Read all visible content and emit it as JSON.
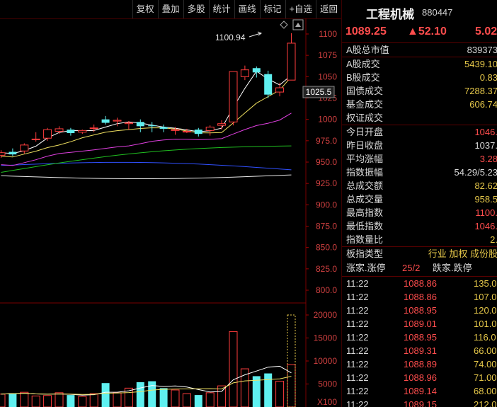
{
  "toolbar": {
    "items": [
      "复权",
      "叠加",
      "多股",
      "统计",
      "画线",
      "标记",
      "+自选",
      "返回"
    ]
  },
  "colors": {
    "up": "#ff3d3d",
    "down": "#5ff0f0",
    "ma5": "#ffffff",
    "ma10": "#f0e060",
    "ma20": "#e040e0",
    "ma60": "#20c020",
    "ma120": "#3050ff",
    "ma250": "#e8e8e8",
    "bg": "#000000"
  },
  "chart": {
    "panel_icons": [
      "diamond-icon",
      "scroll-up-icon"
    ],
    "high_label": "1100.94",
    "current_price_tag": "1025.5",
    "price_axis_ticks": [
      "1100",
      "1075",
      "1050",
      "1025",
      "1000",
      "975.0",
      "950.0",
      "925.0",
      "900.0",
      "875.0",
      "850.0",
      "825.0",
      "800.0"
    ],
    "volume_axis_ticks": [
      "20000",
      "15000",
      "10000",
      "5000"
    ],
    "volume_unit": "X100"
  },
  "chart_data": {
    "type": "candlestick",
    "ylim": [
      800,
      1100
    ],
    "volume_ylim": [
      0,
      20000
    ],
    "candles": [
      {
        "o": 958,
        "h": 964,
        "l": 955,
        "c": 961
      },
      {
        "o": 962,
        "h": 966,
        "l": 957,
        "c": 959
      },
      {
        "o": 963,
        "h": 972,
        "l": 960,
        "c": 970
      },
      {
        "o": 977,
        "h": 985,
        "l": 974,
        "c": 977
      },
      {
        "o": 978,
        "h": 990,
        "l": 975,
        "c": 988
      },
      {
        "o": 986,
        "h": 992,
        "l": 983,
        "c": 989
      },
      {
        "o": 988,
        "h": 990,
        "l": 981,
        "c": 984
      },
      {
        "o": 985,
        "h": 988,
        "l": 983,
        "c": 987
      },
      {
        "o": 990,
        "h": 994,
        "l": 985,
        "c": 990
      },
      {
        "o": 1000,
        "h": 1004,
        "l": 994,
        "c": 996
      },
      {
        "o": 998,
        "h": 1002,
        "l": 992,
        "c": 999
      },
      {
        "o": 995,
        "h": 998,
        "l": 988,
        "c": 996
      },
      {
        "o": 997,
        "h": 1000,
        "l": 985,
        "c": 992
      },
      {
        "o": 993,
        "h": 997,
        "l": 985,
        "c": 992
      },
      {
        "o": 991,
        "h": 994,
        "l": 985,
        "c": 989
      },
      {
        "o": 987,
        "h": 991,
        "l": 982,
        "c": 988
      },
      {
        "o": 986,
        "h": 989,
        "l": 984,
        "c": 986
      },
      {
        "o": 988,
        "h": 990,
        "l": 980,
        "c": 983
      },
      {
        "o": 987,
        "h": 993,
        "l": 981,
        "c": 991
      },
      {
        "o": 993,
        "h": 999,
        "l": 988,
        "c": 995
      },
      {
        "o": 997,
        "h": 1056,
        "l": 993,
        "c": 1056
      },
      {
        "o": 1050,
        "h": 1063,
        "l": 1046,
        "c": 1058
      },
      {
        "o": 1060,
        "h": 1062,
        "l": 1049,
        "c": 1055
      },
      {
        "o": 1053,
        "h": 1057,
        "l": 1025,
        "c": 1029
      },
      {
        "o": 1032,
        "h": 1043,
        "l": 1027,
        "c": 1037
      },
      {
        "o": 1046,
        "h": 1100.94,
        "l": 1046,
        "c": 1089.25
      }
    ],
    "volume": [
      2800,
      3000,
      3200,
      2400,
      2500,
      3100,
      2600,
      2300,
      2900,
      5200,
      3100,
      4100,
      5400,
      5600,
      4100,
      3700,
      2900,
      2600,
      3100,
      4600,
      16400,
      8300,
      6700,
      7300,
      5600,
      9200
    ],
    "volume_outline_max": 20000
  },
  "stock": {
    "name": "工程机械",
    "code": "880447",
    "price": "1089.25",
    "change": "▲52.10",
    "change_pct": "5.02"
  },
  "info_rows": [
    {
      "label": "A股总市值",
      "value": "839373",
      "color": "wht"
    },
    {
      "label": "A股成交",
      "value": "5439.10",
      "color": "yel"
    },
    {
      "label": "B股成交",
      "value": "0.83",
      "color": "yel"
    },
    {
      "label": "国债成交",
      "value": "7288.37",
      "color": "yel"
    },
    {
      "label": "基金成交",
      "value": "606.74",
      "color": "yel"
    },
    {
      "label": "权证成交",
      "value": "",
      "color": "yel"
    },
    {
      "label": "今日开盘",
      "value": "1046.",
      "color": "red"
    },
    {
      "label": "昨日收盘",
      "value": "1037.",
      "color": "wht"
    },
    {
      "label": "平均涨幅",
      "value": "3.28",
      "color": "red"
    },
    {
      "label": "指数振幅",
      "value": "54.29/5.23",
      "color": "wht"
    },
    {
      "label": "总成交额",
      "value": "82.62",
      "color": "yel"
    },
    {
      "label": "总成交量",
      "value": "958.5",
      "color": "yel"
    },
    {
      "label": "最高指数",
      "value": "1100.",
      "color": "red"
    },
    {
      "label": "最低指数",
      "value": "1046.",
      "color": "red"
    },
    {
      "label": "指数量比",
      "value": "2.",
      "color": "yel"
    },
    {
      "label": "板指类型",
      "value": "行业 加权 成份股",
      "color": "yel"
    }
  ],
  "stats": {
    "label": "涨家.涨停",
    "value": "25/2",
    "label2": "跌家.跌停"
  },
  "ticks": [
    {
      "time": "11:22",
      "price": "1088.86",
      "vol": "135.0"
    },
    {
      "time": "11:22",
      "price": "1088.86",
      "vol": "107.0"
    },
    {
      "time": "11:22",
      "price": "1088.95",
      "vol": "120.0"
    },
    {
      "time": "11:22",
      "price": "1089.01",
      "vol": "101.0"
    },
    {
      "time": "11:22",
      "price": "1088.95",
      "vol": "116.0"
    },
    {
      "time": "11:22",
      "price": "1089.31",
      "vol": "66.00"
    },
    {
      "time": "11:22",
      "price": "1088.89",
      "vol": "74.00"
    },
    {
      "time": "11:22",
      "price": "1088.96",
      "vol": "71.00"
    },
    {
      "time": "11:22",
      "price": "1089.14",
      "vol": "68.00"
    },
    {
      "time": "11:22",
      "price": "1089.15",
      "vol": "212.0"
    }
  ]
}
